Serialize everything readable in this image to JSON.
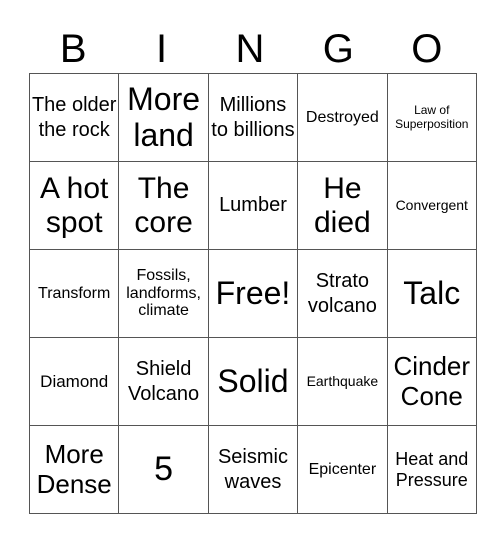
{
  "header": {
    "letters": [
      "B",
      "I",
      "N",
      "G",
      "O"
    ]
  },
  "grid": {
    "rows": [
      [
        "The older the rock",
        "More land",
        "Millions to billions",
        "Destroyed",
        "Law of Superposition"
      ],
      [
        "A hot spot",
        "The core",
        "Lumber",
        "He died",
        "Convergent"
      ],
      [
        "Transform",
        "Fossils, landforms, climate",
        "Free!",
        "Strato volcano",
        "Talc"
      ],
      [
        "Diamond",
        "Shield Volcano",
        "Solid",
        "Earthquake",
        "Cinder Cone"
      ],
      [
        "More Dense",
        "5",
        "Seismic waves",
        "Epicenter",
        "Heat and Pressure"
      ]
    ]
  }
}
